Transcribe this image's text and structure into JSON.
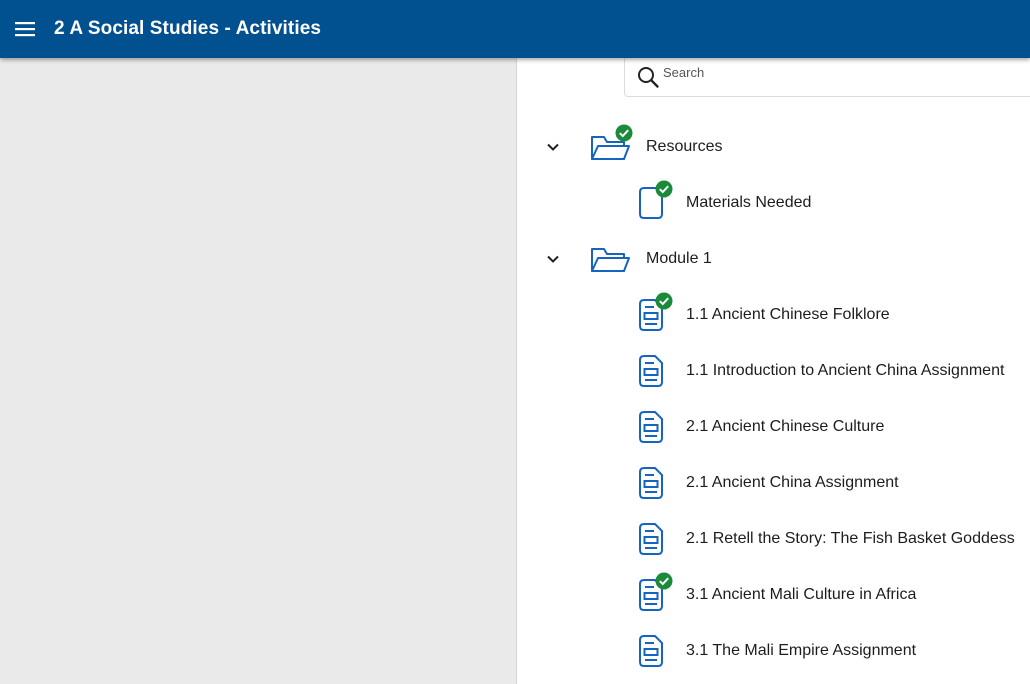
{
  "app": {
    "title": "2 A Social Studies - Activities"
  },
  "search": {
    "placeholder": "Search",
    "value": ""
  },
  "colors": {
    "header": "#01508f",
    "icon_blue": "#1565c0",
    "check_green": "#1b8a3a",
    "left_pane": "#eaeaea"
  },
  "tree": {
    "resources": {
      "label": "Resources",
      "expanded": true,
      "completed": true,
      "items": [
        {
          "label": "Materials Needed",
          "icon": "document-icon",
          "completed": true
        }
      ]
    },
    "module1": {
      "label": "Module 1",
      "expanded": true,
      "completed": false,
      "items": [
        {
          "label": "1.1 Ancient Chinese Folklore",
          "icon": "assignment-icon",
          "completed": true
        },
        {
          "label": "1.1 Introduction to Ancient China Assignment",
          "icon": "assignment-icon",
          "completed": false
        },
        {
          "label": "2.1 Ancient Chinese Culture",
          "icon": "assignment-icon",
          "completed": false
        },
        {
          "label": "2.1 Ancient China Assignment",
          "icon": "assignment-icon",
          "completed": false
        },
        {
          "label": "2.1 Retell the Story: The Fish Basket Goddess",
          "icon": "assignment-icon",
          "completed": false
        },
        {
          "label": "3.1 Ancient Mali Culture in Africa",
          "icon": "assignment-icon",
          "completed": true
        },
        {
          "label": "3.1 The Mali Empire Assignment",
          "icon": "assignment-icon",
          "completed": false
        }
      ]
    }
  }
}
